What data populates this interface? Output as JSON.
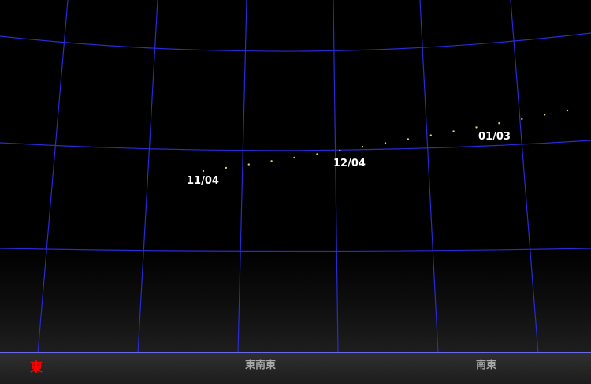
{
  "colors": {
    "background": "#000000",
    "grid_line": "#2a2ad6",
    "comet_point": "#e0d050",
    "date_label": "#ffffff",
    "horizon_bar": "#262626",
    "cardinal_east": "#ff0000",
    "direction_label": "#a8a8a8"
  },
  "date_labels": [
    "11/04",
    "12/04",
    "01/03"
  ],
  "directions": {
    "east": "東",
    "east_southeast": "東南東",
    "southeast": "南東"
  },
  "comet_track": {
    "point_count": 17
  }
}
